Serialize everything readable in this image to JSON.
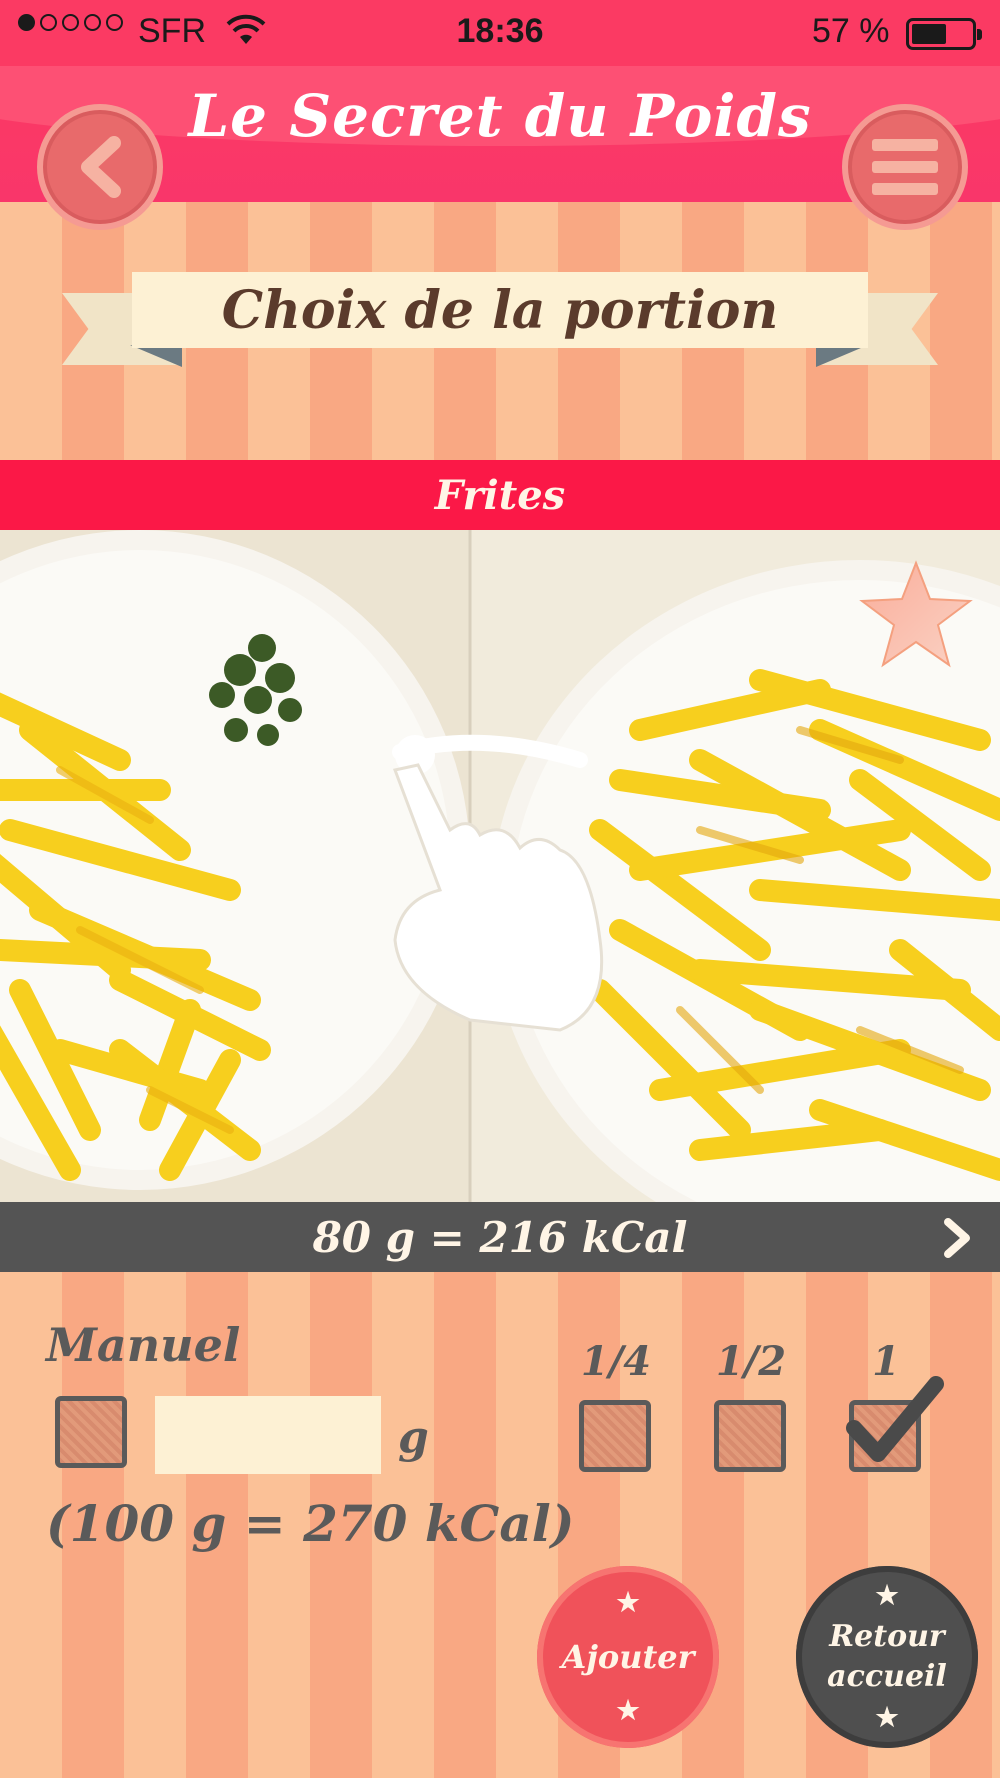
{
  "status_bar": {
    "carrier": "SFR",
    "time": "18:36",
    "battery": "57 %",
    "battery_level": 0.57,
    "signal_bars_filled": 1,
    "signal_bars_total": 5
  },
  "header": {
    "title": "Le Secret du Poids",
    "back_icon": "chevron-left-icon",
    "menu_icon": "hamburger-menu-icon"
  },
  "page": {
    "heading": "Choix de la portion"
  },
  "food": {
    "name": "Frites",
    "portion_summary": "80 g = 216 kCal",
    "favorite_icon": "star-icon",
    "swipe_icon": "swipe-hand-icon"
  },
  "manual": {
    "label": "Manuel",
    "grams_value": "",
    "unit": "g",
    "reference": "(100 g = 270 kCal)"
  },
  "portions": [
    {
      "label": "1/4",
      "checked": false
    },
    {
      "label": "1/2",
      "checked": false
    },
    {
      "label": "1",
      "checked": true
    }
  ],
  "actions": {
    "add_label": "Ajouter",
    "home_label_line1": "Retour",
    "home_label_line2": "accueil"
  },
  "colors": {
    "header": "#fb3a63",
    "food_bar": "#fb1847",
    "kcal_bar": "#545454",
    "add_button": "#f0525a",
    "home_button": "#4f4f4f",
    "stripe_light": "#fbc197",
    "stripe_dark": "#f9a883"
  }
}
